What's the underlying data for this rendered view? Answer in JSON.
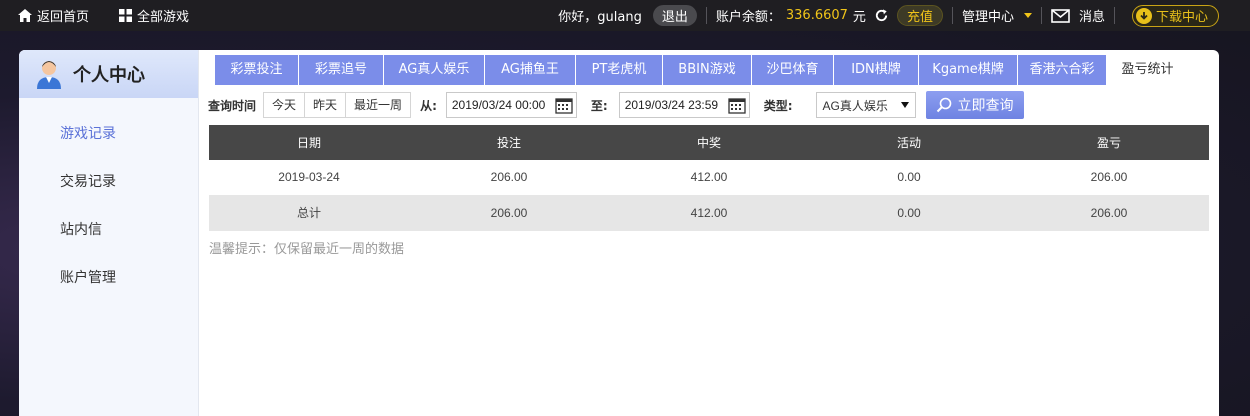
{
  "topbar": {
    "home_label": "返回首页",
    "all_games_label": "全部游戏",
    "greeting": "你好，gulang",
    "logout_label": "退出",
    "balance_label": "账户余额：",
    "balance_value": "336.6607",
    "balance_unit": "元",
    "recharge_label": "充值",
    "manage_label": "管理中心",
    "message_label": "消息",
    "download_label": "下载中心"
  },
  "sidebar": {
    "title": "个人中心",
    "items": [
      {
        "label": "游戏记录",
        "active": true
      },
      {
        "label": "交易记录",
        "active": false
      },
      {
        "label": "站内信",
        "active": false
      },
      {
        "label": "账户管理",
        "active": false
      }
    ]
  },
  "tabs": [
    {
      "label": "彩票投注"
    },
    {
      "label": "彩票追号"
    },
    {
      "label": "AG真人娱乐"
    },
    {
      "label": "AG捕鱼王"
    },
    {
      "label": "PT老虎机"
    },
    {
      "label": "BBIN游戏"
    },
    {
      "label": "沙巴体育"
    },
    {
      "label": "IDN棋牌"
    },
    {
      "label": "Kgame棋牌"
    },
    {
      "label": "香港六合彩"
    },
    {
      "label": "盈亏统计",
      "active": true
    }
  ],
  "filter": {
    "query_time_label": "查询时间",
    "quick": [
      "今天",
      "昨天",
      "最近一周"
    ],
    "from_label": "从:",
    "from_value": "2019/03/24 00:00",
    "to_label": "至:",
    "to_value": "2019/03/24 23:59",
    "type_label": "类型:",
    "type_value": "AG真人娱乐",
    "search_label": "立即查询"
  },
  "table": {
    "headers": [
      "日期",
      "投注",
      "中奖",
      "活动",
      "盈亏"
    ],
    "rows": [
      [
        "2019-03-24",
        "206.00",
        "412.00",
        "0.00",
        "206.00"
      ]
    ],
    "total": [
      "总计",
      "206.00",
      "412.00",
      "0.00",
      "206.00"
    ]
  },
  "hint": "温馨提示：仅保留最近一周的数据",
  "colors": {
    "accent": "#7b8de9",
    "active_menu": "#5b72d8",
    "gold": "#f0c419",
    "table_header": "#474747"
  }
}
